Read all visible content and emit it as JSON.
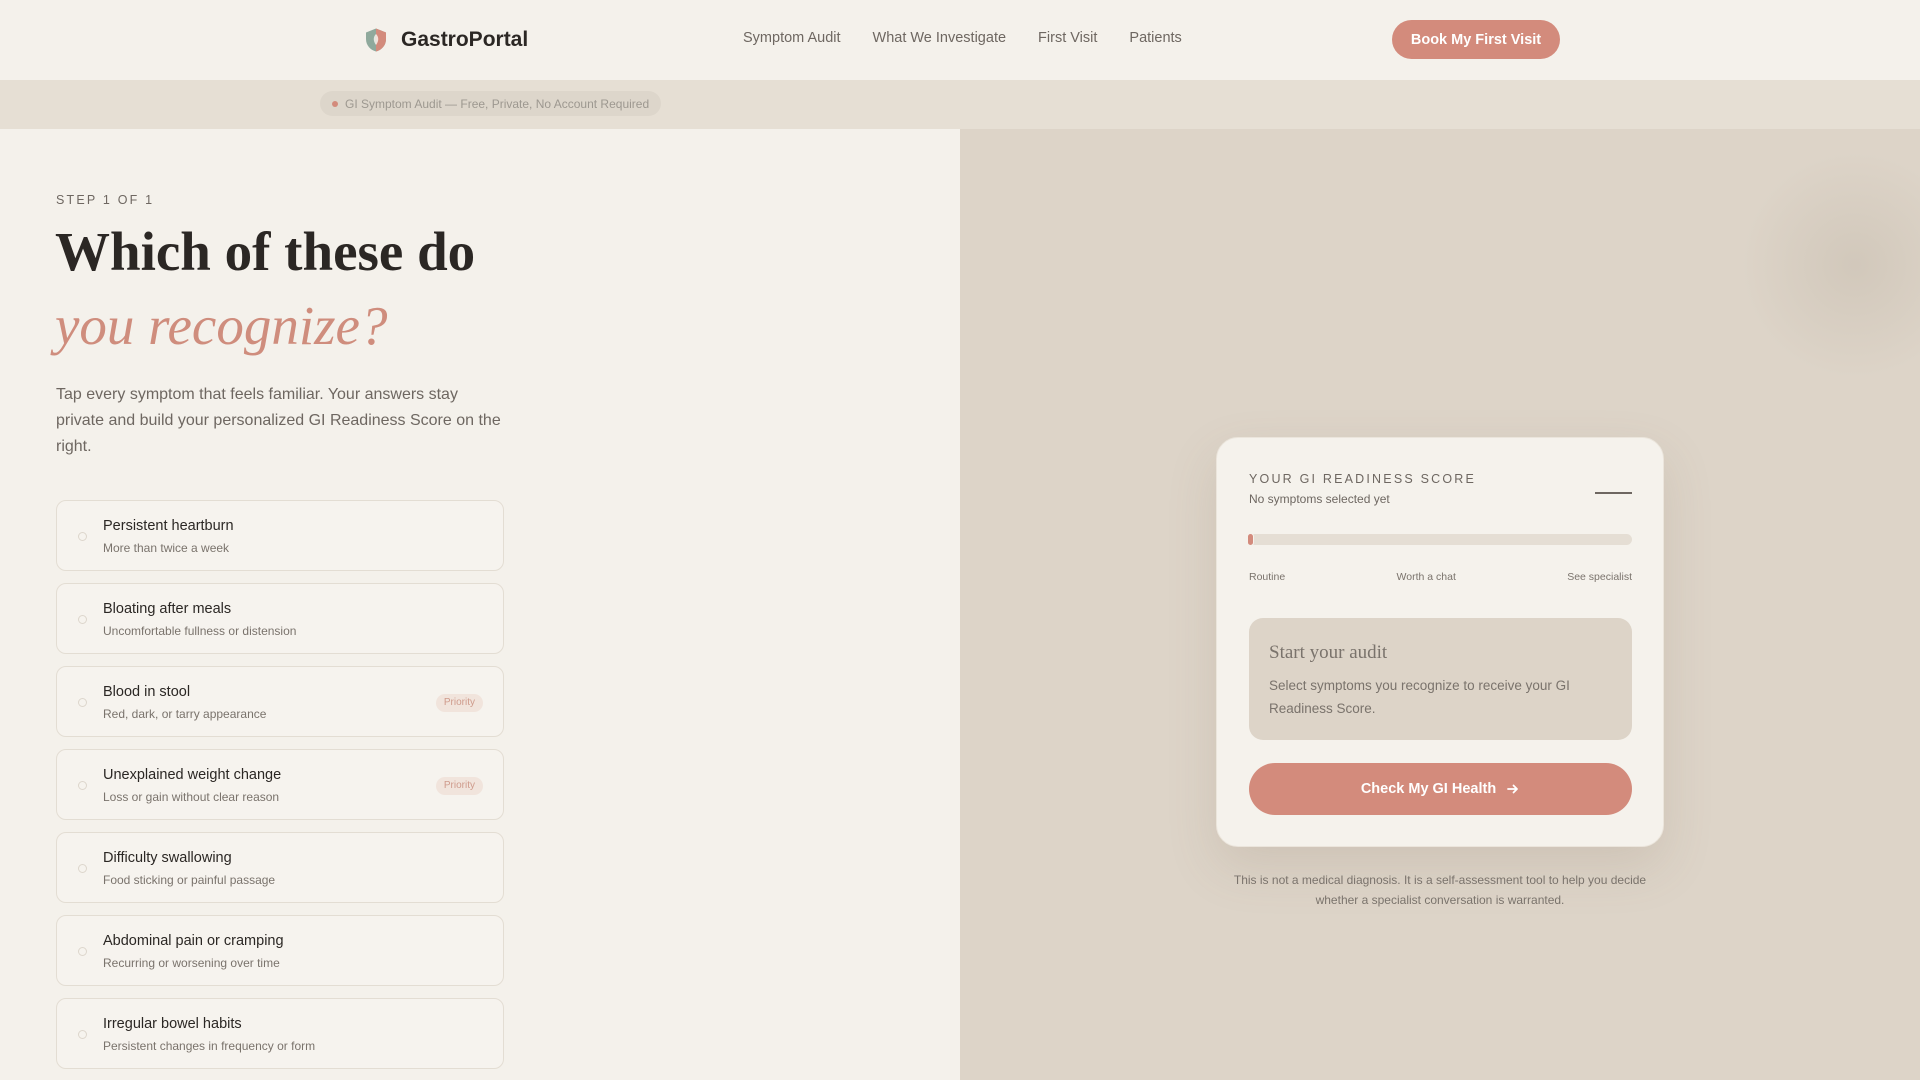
{
  "nav": {
    "brand": "GastroPortal",
    "brand_icon": "shield-icon",
    "links": [
      "Symptom Audit",
      "What We Investigate",
      "First Visit",
      "Patients"
    ],
    "cta": "Book My First Visit"
  },
  "band": {
    "text": "GI Symptom Audit — Free, Private, No Account Required"
  },
  "hero": {
    "step": "STEP 1 OF 1",
    "headline_line1": "Which of these do",
    "headline_line2": "you recognize?",
    "intro": "Tap every symptom that feels familiar. Your answers stay private and build your personalized GI Readiness Score on the right."
  },
  "symptoms": [
    {
      "title": "Persistent heartburn",
      "subtitle": "More than twice a week",
      "badge": ""
    },
    {
      "title": "Bloating after meals",
      "subtitle": "Uncomfortable fullness or distension",
      "badge": ""
    },
    {
      "title": "Blood in stool",
      "subtitle": "Red, dark, or tarry appearance",
      "badge": "Priority"
    },
    {
      "title": "Unexplained weight change",
      "subtitle": "Loss or gain without clear reason",
      "badge": "Priority"
    },
    {
      "title": "Difficulty swallowing",
      "subtitle": "Food sticking or painful passage",
      "badge": ""
    },
    {
      "title": "Abdominal pain or cramping",
      "subtitle": "Recurring or worsening over time",
      "badge": ""
    },
    {
      "title": "Irregular bowel habits",
      "subtitle": "Persistent changes in frequency or form",
      "badge": ""
    }
  ],
  "score_card": {
    "label": "YOUR GI READINESS SCORE",
    "status": "No symptoms selected yet",
    "score_value": "—",
    "progress": 0,
    "scale": [
      "Routine",
      "Worth a chat",
      "See specialist"
    ],
    "audit_title": "Start your audit",
    "audit_text": "Select symptoms you recognize to receive your GI Readiness Score.",
    "button": "Check My GI Health",
    "button_icon": "arrow-right-icon"
  },
  "disclaimer": "This is not a medical diagnosis. It is a self-assessment tool to help you decide whether a specialist conversation is warranted.",
  "colors": {
    "accent": "#d38b7c",
    "background": "#f4f1eb",
    "panel": "#ddd4c8"
  }
}
